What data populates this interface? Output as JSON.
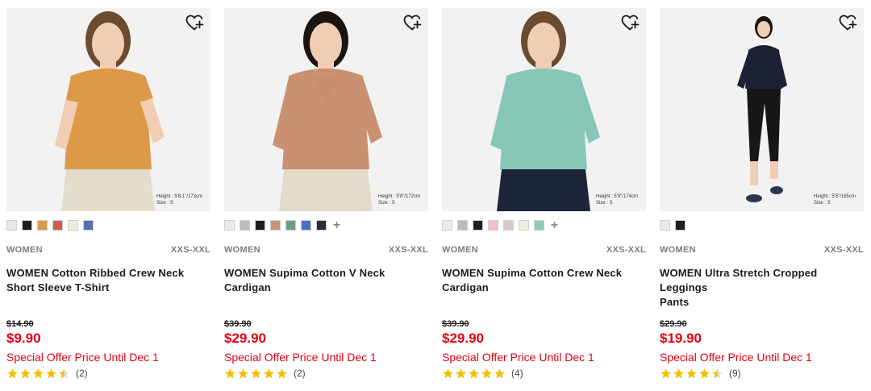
{
  "colors": {
    "sale_red": "#e60012",
    "star_gold": "#f4bf00",
    "photo_bg": "#f2f2f2"
  },
  "products": [
    {
      "gender": "WOMEN",
      "sizes": "XXS-XXL",
      "title_line1": "WOMEN Cotton Ribbed Crew Neck",
      "title_line2": "Short Sleeve T-Shirt",
      "original_price": "$14.90",
      "sale_price": "$9.90",
      "promo": "Special Offer Price Until Dec 1",
      "rating": 4.5,
      "review_count": "(2)",
      "model_height": "Height : 5'8.1\"/173cm",
      "model_size": "Size : S",
      "swatches": [
        "#e8e8e8",
        "#1e1e1e",
        "#d99a4e",
        "#d65a4c",
        "#f3edd8",
        "#5b6fae"
      ],
      "has_more_colors": false,
      "garment_color": "#dc9a48",
      "bottom_color": "#e4ddcc"
    },
    {
      "gender": "WOMEN",
      "sizes": "XXS-XXL",
      "title_line1": "WOMEN Supima Cotton V Neck",
      "title_line2": "Cardigan",
      "original_price": "$39.90",
      "sale_price": "$29.90",
      "promo": "Special Offer Price Until Dec 1",
      "rating": 5,
      "review_count": "(2)",
      "model_height": "Height : 5'8\"/172cm",
      "model_size": "Size : S",
      "swatches": [
        "#eaeaea",
        "#b9bcc3",
        "#1e1e1e",
        "#c99377",
        "#6e9c80",
        "#4a6fc9",
        "#2a2c3c"
      ],
      "has_more_colors": true,
      "garment_color": "#c99172",
      "bottom_color": "#e3dccd"
    },
    {
      "gender": "WOMEN",
      "sizes": "XXS-XXL",
      "title_line1": "WOMEN Supima Cotton Crew Neck",
      "title_line2": "Cardigan",
      "original_price": "$39.90",
      "sale_price": "$29.90",
      "promo": "Special Offer Price Until Dec 1",
      "rating": 5,
      "review_count": "(4)",
      "model_height": "Height : 5'9\"/174cm",
      "model_size": "Size : S",
      "swatches": [
        "#eaeaea",
        "#b9bcc3",
        "#1e1e1e",
        "#f3bfc3",
        "#d9c7c3",
        "#eeeedd",
        "#8ecbbd"
      ],
      "has_more_colors": true,
      "garment_color": "#88c6b8",
      "bottom_color": "#1c2538"
    },
    {
      "gender": "WOMEN",
      "sizes": "XXS-XXL",
      "title_line1": "WOMEN Ultra Stretch Cropped Leggings",
      "title_line2": "Pants",
      "original_price": "$29.90",
      "sale_price": "$19.90",
      "promo": "Special Offer Price Until Dec 1",
      "rating": 4.5,
      "review_count": "(9)",
      "model_height": "Height : 5'5\"/165cm",
      "model_size": "Size : S",
      "swatches": [
        "#eaeaea",
        "#1e1e1e"
      ],
      "has_more_colors": false,
      "garment_color": "#1c2233",
      "bottom_color": "#161616"
    }
  ],
  "icons": {
    "favorite": "heart-plus-icon",
    "star": "star-icon",
    "more_colors": "plus-icon"
  }
}
